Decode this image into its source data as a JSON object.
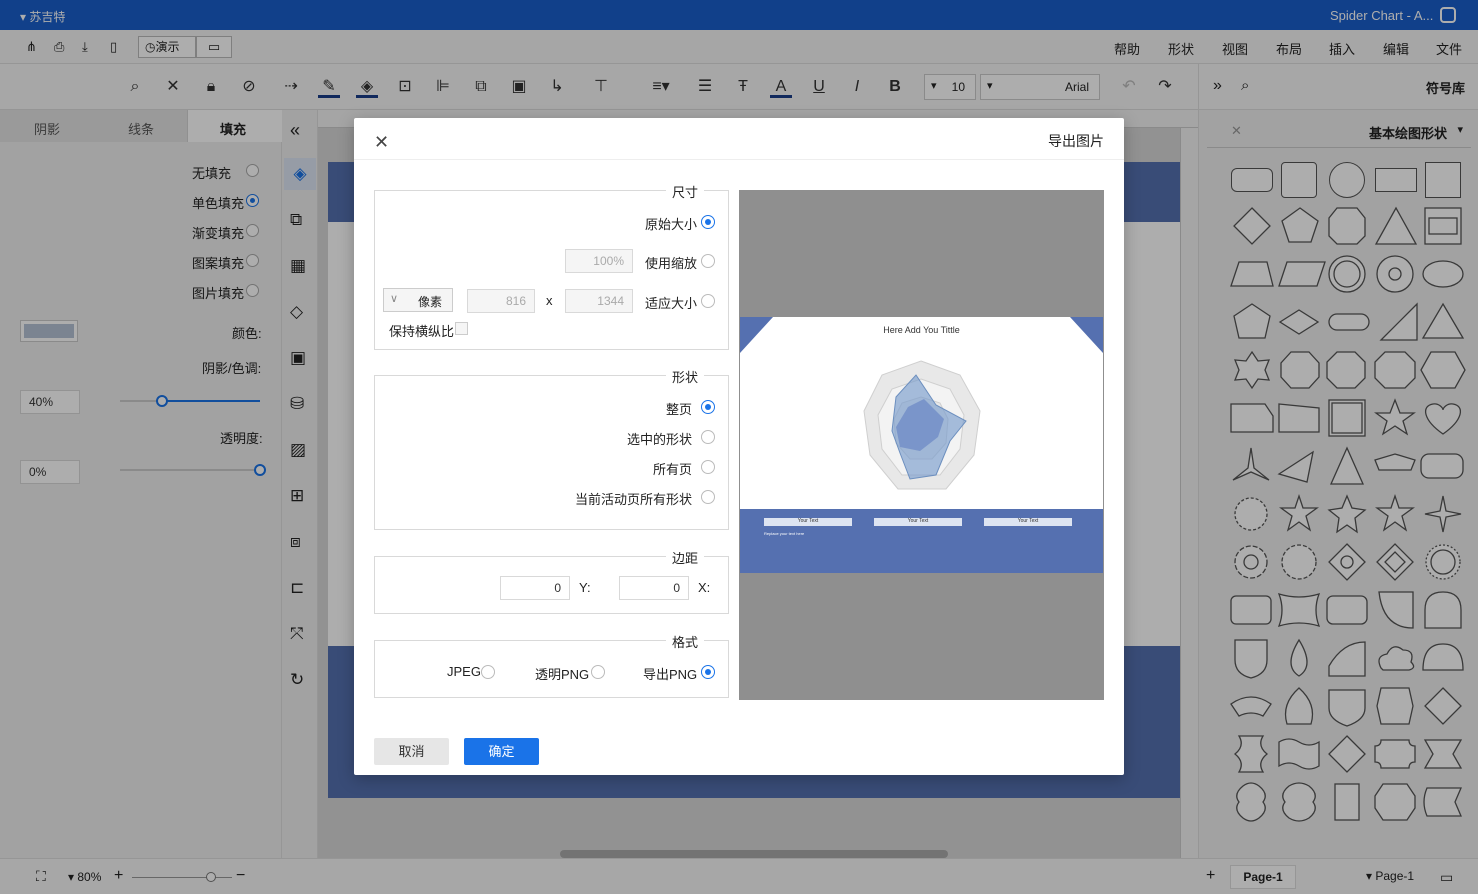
{
  "titlebar": {
    "app_name": "Spider Chart - A...",
    "user": "苏吉特"
  },
  "menu": [
    "文件",
    "编辑",
    "插入",
    "布局",
    "视图",
    "形状",
    "帮助"
  ],
  "menu_actions": {
    "present": "演示"
  },
  "toolbar": {
    "font": "Arial",
    "font_size": "10"
  },
  "right_panel": {
    "title": "符号库",
    "library": "基本绘图形状"
  },
  "left_panel": {
    "tabs": [
      "填充",
      "线条",
      "阴影"
    ],
    "fill_options": [
      "无填充",
      "单色填充",
      "渐变填充",
      "图案填充",
      "图片填充"
    ],
    "color_label": "颜色:",
    "shade_label": "阴影/色调:",
    "shade_value": "40%",
    "opacity_label": "透明度:",
    "opacity_value": "0%"
  },
  "dialog": {
    "title": "导出图片",
    "size": {
      "legend": "尺寸",
      "original": "原始大小",
      "scale": "使用缩放",
      "scale_value": "100%",
      "fit": "适应大小",
      "width": "1344",
      "height": "816",
      "x_sep": "x",
      "unit": "像素",
      "keep_ratio": "保持横纵比"
    },
    "shape": {
      "legend": "形状",
      "options": [
        "整页",
        "选中的形状",
        "所有页",
        "当前活动页所有形状"
      ]
    },
    "margin": {
      "legend": "边距",
      "x_label": "X:",
      "x_value": "0",
      "y_label": "Y:",
      "y_value": "0"
    },
    "format": {
      "legend": "格式",
      "options": [
        "导出PNG",
        "透明PNG",
        "JPEG"
      ]
    },
    "ok": "确定",
    "cancel": "取消"
  },
  "preview": {
    "chart_title": "Here Add You Tittle",
    "table_header": "Your Text",
    "table_cell": "Replace your text here"
  },
  "statusbar": {
    "page_tab": "Page-1",
    "page_select": "Page-1",
    "zoom": "80%"
  },
  "colors": {
    "accent": "#1a73e8",
    "titlebar": "#1a5fcc",
    "slide_blue": "#5570b0"
  }
}
